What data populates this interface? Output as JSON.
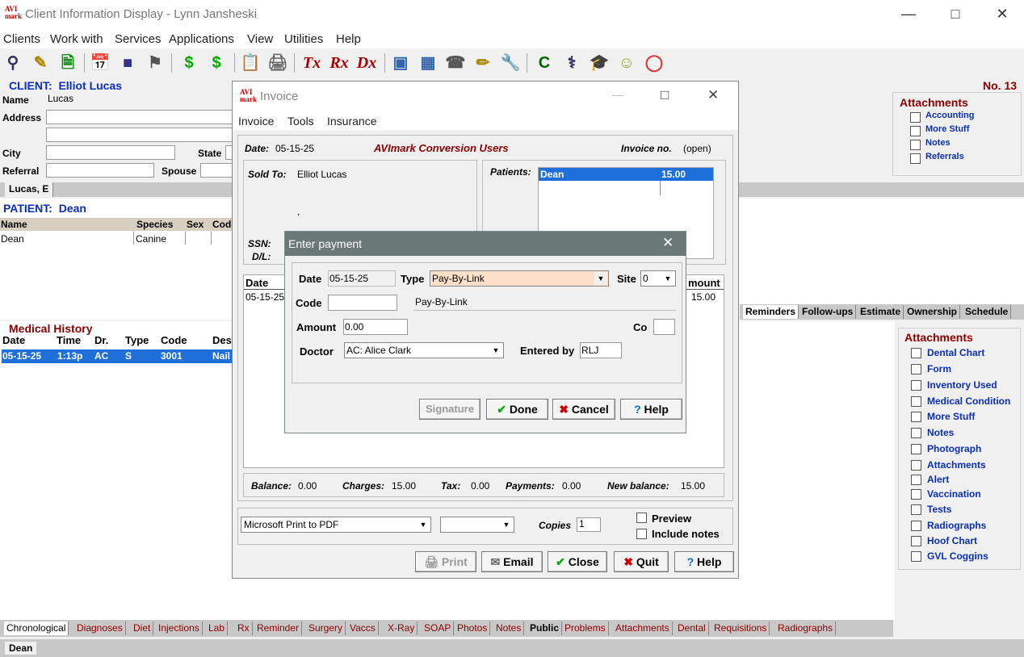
{
  "window": {
    "title": "Client Information Display - Lynn Jansheski",
    "logo": "AVI mark"
  },
  "menu": [
    "Clients",
    "Work with",
    "Services",
    "Applications",
    "View",
    "Utilities",
    "Help"
  ],
  "client": {
    "heading_label": "CLIENT:",
    "name_full": "Elliot Lucas",
    "number": "No. 13",
    "name_label": "Name",
    "name_value": "Lucas",
    "address_label": "Address",
    "city_label": "City",
    "state_label": "State",
    "referral_label": "Referral",
    "spouse_label": "Spouse",
    "tab": "Lucas, E"
  },
  "client_attachments": {
    "title": "Attachments",
    "items": [
      "Accounting",
      "More Stuff",
      "Notes",
      "Referrals"
    ]
  },
  "patient": {
    "heading_label": "PATIENT:",
    "name": "Dean",
    "columns": [
      "Name",
      "Species",
      "Sex",
      "Cod"
    ],
    "row": [
      "Dean",
      "Canine",
      "",
      ""
    ],
    "tabs": [
      "Reminders",
      "Follow-ups",
      "Estimate",
      "Ownership",
      "Schedule"
    ]
  },
  "medical_history": {
    "title": "Medical History",
    "columns": [
      "Date",
      "Time",
      "Dr.",
      "Type",
      "Code",
      "Des"
    ],
    "row": [
      "05-15-25",
      "1:13p",
      "AC",
      "S",
      "3001",
      "Nail"
    ]
  },
  "patient_attachments": {
    "title": "Attachments",
    "items": [
      "Dental Chart",
      "Form",
      "Inventory Used",
      "Medical Condition",
      "More Stuff",
      "Notes",
      "Photograph",
      "Attachments",
      "Alert",
      "Vaccination",
      "Tests",
      "Radiographs",
      "Hoof Chart",
      "GVL Coggins"
    ]
  },
  "bottom_tabs": [
    "Chronological",
    "Diagnoses",
    "Diet",
    "Injections",
    "Lab",
    "Rx",
    "Reminder",
    "Surgery",
    "Vaccs",
    "X-Ray",
    "SOAP",
    "Photos",
    "Notes",
    "Public",
    "Problems",
    "Attachments",
    "Dental",
    "Requisitions",
    "Radiographs"
  ],
  "bottom_patient_tab": "Dean",
  "invoice": {
    "title": "Invoice",
    "menu": [
      "Invoice",
      "Tools",
      "Insurance"
    ],
    "date_label": "Date:",
    "date": "05-15-25",
    "company": "AVImark Conversion Users",
    "invoice_no_label": "Invoice no.",
    "invoice_no": "(open)",
    "sold_to_label": "Sold To:",
    "sold_to": "Elliot Lucas",
    "comma": ",",
    "ssn_label": "SSN:",
    "dl_label": "D/L:",
    "patients_label": "Patients:",
    "patient_name": "Dean",
    "patient_amount": "15.00",
    "col_date": "Date",
    "col_amount": "mount",
    "line_date": "05-15-25",
    "line_amount": "15.00",
    "balance_label": "Balance:",
    "balance": "0.00",
    "charges_label": "Charges:",
    "charges": "15.00",
    "tax_label": "Tax:",
    "tax": "0.00",
    "payments_label": "Payments:",
    "payments": "0.00",
    "new_balance_label": "New balance:",
    "new_balance": "15.00",
    "printer": "Microsoft Print to PDF",
    "copies_label": "Copies",
    "copies": "1",
    "preview_label": "Preview",
    "include_notes_label": "Include notes",
    "buttons": {
      "print": "Print",
      "email": "Email",
      "close": "Close",
      "quit": "Quit",
      "help": "Help"
    }
  },
  "payment": {
    "title": "Enter payment",
    "date_label": "Date",
    "date": "05-15-25",
    "type_label": "Type",
    "type": "Pay-By-Link",
    "site_label": "Site",
    "site": "0",
    "code_label": "Code",
    "code": "",
    "code_desc": "Pay-By-Link",
    "amount_label": "Amount",
    "amount": "0.00",
    "co_label": "Co",
    "co": "",
    "doctor_label": "Doctor",
    "doctor": "AC: Alice Clark",
    "entered_by_label": "Entered by",
    "entered_by": "RLJ",
    "buttons": {
      "signature": "Signature",
      "done": "Done",
      "cancel": "Cancel",
      "help": "Help"
    }
  },
  "colors": {
    "accent_blue": "#0a2fb8",
    "maroon": "#8b0000",
    "selection": "#1e6fd9",
    "type_field": "#fde0c8"
  }
}
